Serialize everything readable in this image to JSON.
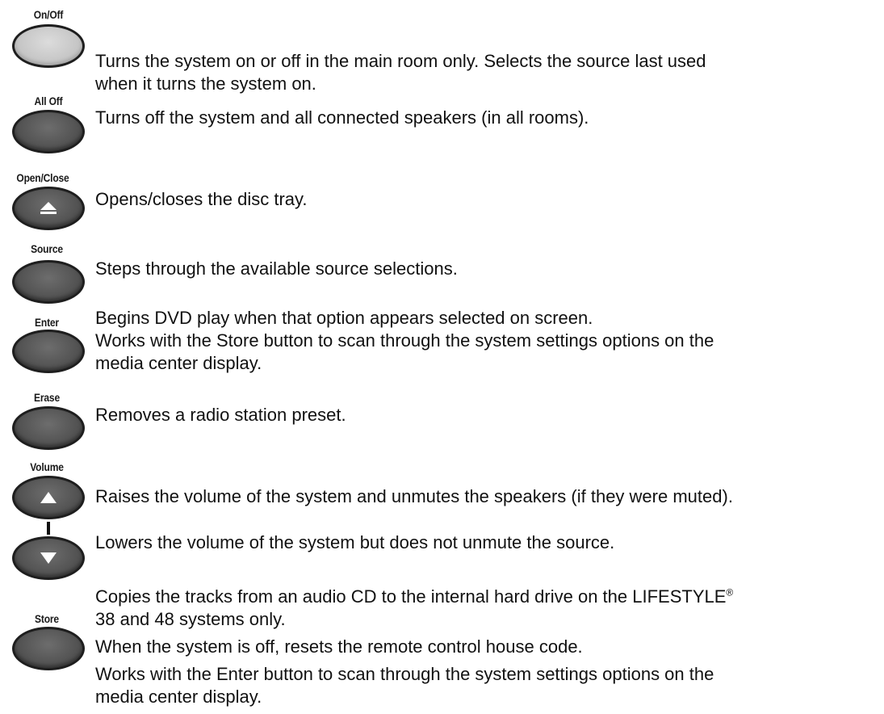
{
  "buttons": {
    "onoff": {
      "label": "On/Off",
      "desc1": "Turns the system on or off in the main room only. Selects the source last used",
      "desc2": "when it turns the system on."
    },
    "alloff": {
      "label": "All Off",
      "desc1": "Turns off the system and all connected speakers (in all rooms)."
    },
    "openclose": {
      "label": "Open/Close",
      "desc1": "Opens/closes the disc tray."
    },
    "source": {
      "label": "Source",
      "desc1": "Steps through the available source selections."
    },
    "enter": {
      "label": "Enter",
      "desc1": "Begins DVD play when that option appears selected on screen.",
      "desc2": "Works with the Store button to scan through the system settings options on the",
      "desc3": "media center display."
    },
    "erase": {
      "label": "Erase",
      "desc1": "Removes a radio station preset."
    },
    "volume": {
      "label": "Volume",
      "up_desc": "Raises the volume of the system and unmutes the speakers (if they were muted).",
      "down_desc": "Lowers the volume of the system but does not unmute the source."
    },
    "store": {
      "label": "Store",
      "desc1_pre": "Copies the tracks from an audio CD to the internal hard drive on the LIFESTYLE",
      "desc1_reg": "®",
      "desc2": "38 and 48 systems only.",
      "desc3": "When the system is off, resets the remote control house code.",
      "desc4": "Works with the Enter button to scan through the system settings options on the",
      "desc5": "media center display."
    }
  },
  "icons": {
    "eject": "eject-icon",
    "up": "triangle-up-icon",
    "down": "triangle-down-icon"
  }
}
